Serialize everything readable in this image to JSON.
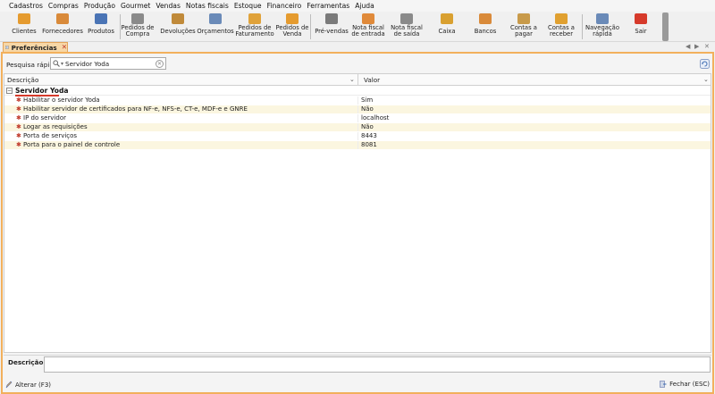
{
  "menu": [
    "Cadastros",
    "Compras",
    "Produção",
    "Gourmet",
    "Vendas",
    "Notas fiscais",
    "Estoque",
    "Financeiro",
    "Ferramentas",
    "Ajuda"
  ],
  "toolbar": [
    {
      "label": "Clientes",
      "icon": "clients-icon",
      "color": "#e59b2f"
    },
    {
      "label": "Fornecedores",
      "icon": "suppliers-icon",
      "color": "#d98a3a"
    },
    {
      "label": "Produtos",
      "icon": "products-icon",
      "color": "#4a74b5"
    },
    {
      "label": "Pedidos de\nCompra",
      "icon": "purchase-orders-icon",
      "color": "#8a8a8a"
    },
    {
      "label": "Devoluções",
      "icon": "returns-icon",
      "color": "#c08a3a"
    },
    {
      "label": "Orçamentos",
      "icon": "quotes-icon",
      "color": "#6a8ab8"
    },
    {
      "label": "Pedidos de\nFaturamento",
      "icon": "billing-orders-icon",
      "color": "#e0a23a"
    },
    {
      "label": "Pedidos de\nVenda",
      "icon": "sales-orders-icon",
      "color": "#e59b2f"
    },
    {
      "label": "Pré-vendas",
      "icon": "pre-sales-icon",
      "color": "#7a7a7a"
    },
    {
      "label": "Nota fiscal\nde entrada",
      "icon": "inbound-invoice-icon",
      "color": "#e08a3a"
    },
    {
      "label": "Nota fiscal\nde saída",
      "icon": "outbound-invoice-icon",
      "color": "#8a8a8a"
    },
    {
      "label": "Caixa",
      "icon": "cash-icon",
      "color": "#d9a030"
    },
    {
      "label": "Bancos",
      "icon": "banks-icon",
      "color": "#d98a3a"
    },
    {
      "label": "Contas a\npagar",
      "icon": "payables-icon",
      "color": "#c89a4a"
    },
    {
      "label": "Contas a\nreceber",
      "icon": "receivables-icon",
      "color": "#e0a030"
    },
    {
      "label": "Navegação\nrápida",
      "icon": "quick-nav-icon",
      "color": "#6a8ab8"
    },
    {
      "label": "Sair",
      "icon": "exit-icon",
      "color": "#d63a2b"
    }
  ],
  "tab": {
    "label": "Preferências",
    "close": "✕"
  },
  "search": {
    "label": "Pesquisa rápida",
    "value": "Servidor Yoda"
  },
  "grid": {
    "columns": [
      "Descrição",
      "Valor"
    ],
    "group": "Servidor Yoda",
    "rows": [
      {
        "description": "Habilitar o servidor Yoda",
        "value": "Sim"
      },
      {
        "description": "Habilitar servidor de certificados para NF-e, NFS-e, CT-e, MDF-e e GNRE",
        "value": "Não"
      },
      {
        "description": "IP do servidor",
        "value": "localhost"
      },
      {
        "description": "Logar as requisições",
        "value": "Não"
      },
      {
        "description": "Porta de serviços",
        "value": "8443"
      },
      {
        "description": "Porta para o painel de controle",
        "value": "8081"
      }
    ]
  },
  "description_panel": {
    "label": "Descrição:"
  },
  "bottom": {
    "edit_label": "Alterar (F3)",
    "close_label": "Fechar (ESC)"
  },
  "colors": {
    "accent": "#f2b05c",
    "tab_fill": "#f7d7a6",
    "group_underline": "#d63a2b",
    "alt_row": "#fbf6e0"
  }
}
